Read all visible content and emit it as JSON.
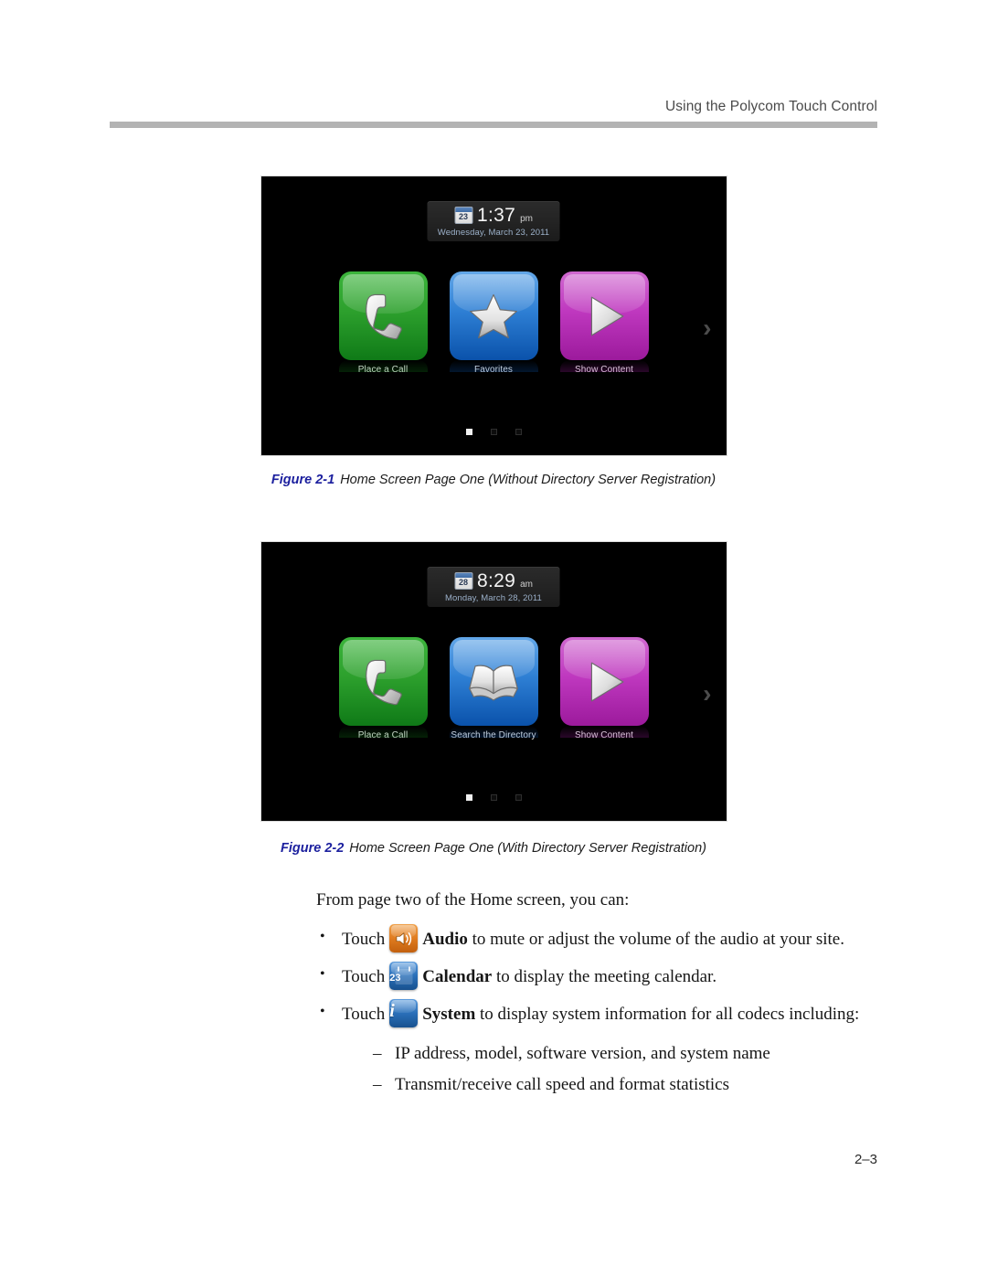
{
  "header": {
    "running_head": "Using the Polycom Touch Control"
  },
  "figures": [
    {
      "id": "figure-2-1",
      "number": "Figure 2-1",
      "caption": "Home Screen Page One (Without Directory Server Registration)",
      "screen": {
        "clock": {
          "calendar_day": "23",
          "time": "1:37",
          "meridiem": "pm",
          "date": "Wednesday, March 23, 2011"
        },
        "tiles": [
          {
            "label": "Place a Call",
            "color": "#2da02d",
            "icon": "phone-handset-icon"
          },
          {
            "label": "Favorites",
            "color": "#2e7fd4",
            "icon": "star-icon"
          },
          {
            "label": "Show Content",
            "color": "#bf38bf",
            "icon": "play-triangle-icon"
          }
        ],
        "next_arrow": "›",
        "page_dots": {
          "count": 3,
          "active_index": 0
        }
      }
    },
    {
      "id": "figure-2-2",
      "number": "Figure 2-2",
      "caption": "Home Screen Page One (With Directory Server Registration)",
      "screen": {
        "clock": {
          "calendar_day": "28",
          "time": "8:29",
          "meridiem": "am",
          "date": "Monday, March 28, 2011"
        },
        "tiles": [
          {
            "label": "Place a Call",
            "color": "#2da02d",
            "icon": "phone-handset-icon"
          },
          {
            "label": "Search the Directory",
            "color": "#2e7fd4",
            "icon": "open-book-icon"
          },
          {
            "label": "Show Content",
            "color": "#bf38bf",
            "icon": "play-triangle-icon"
          }
        ],
        "next_arrow": "›",
        "page_dots": {
          "count": 3,
          "active_index": 0
        }
      }
    }
  ],
  "body": {
    "intro": "From page two of the Home screen, you can:",
    "bullet_mark": "•",
    "subbullet_mark": "–",
    "bullets": [
      {
        "lead": "Touch",
        "icon_name": "audio-speaker-icon",
        "icon_label": "",
        "bold_term": "Audio",
        "rest": " to mute or adjust the volume of the audio at your site."
      },
      {
        "lead": "Touch",
        "icon_name": "calendar-icon",
        "icon_label": "23",
        "bold_term": "Calendar",
        "rest": " to display the meeting calendar."
      },
      {
        "lead": "Touch",
        "icon_name": "system-info-icon",
        "icon_label": "i",
        "bold_term": "System",
        "rest": " to display system information for all codecs including:"
      }
    ],
    "subbullets": [
      "IP address, model, software version, and system name",
      "Transmit/receive call speed and format statistics"
    ]
  },
  "footer": {
    "page_number": "2–3"
  },
  "colors": {
    "figure_number": "#1b1f9e",
    "header_rule": "#b3b3b3",
    "screen_background": "#000000"
  }
}
